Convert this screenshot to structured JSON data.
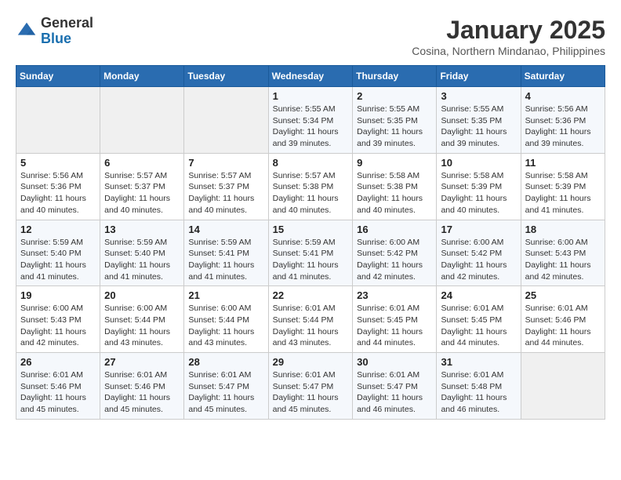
{
  "header": {
    "logo_line1": "General",
    "logo_line2": "Blue",
    "month": "January 2025",
    "location": "Cosina, Northern Mindanao, Philippines"
  },
  "weekdays": [
    "Sunday",
    "Monday",
    "Tuesday",
    "Wednesday",
    "Thursday",
    "Friday",
    "Saturday"
  ],
  "weeks": [
    [
      {
        "day": "",
        "sunrise": "",
        "sunset": "",
        "daylight": ""
      },
      {
        "day": "",
        "sunrise": "",
        "sunset": "",
        "daylight": ""
      },
      {
        "day": "",
        "sunrise": "",
        "sunset": "",
        "daylight": ""
      },
      {
        "day": "1",
        "sunrise": "Sunrise: 5:55 AM",
        "sunset": "Sunset: 5:34 PM",
        "daylight": "Daylight: 11 hours and 39 minutes."
      },
      {
        "day": "2",
        "sunrise": "Sunrise: 5:55 AM",
        "sunset": "Sunset: 5:35 PM",
        "daylight": "Daylight: 11 hours and 39 minutes."
      },
      {
        "day": "3",
        "sunrise": "Sunrise: 5:55 AM",
        "sunset": "Sunset: 5:35 PM",
        "daylight": "Daylight: 11 hours and 39 minutes."
      },
      {
        "day": "4",
        "sunrise": "Sunrise: 5:56 AM",
        "sunset": "Sunset: 5:36 PM",
        "daylight": "Daylight: 11 hours and 39 minutes."
      }
    ],
    [
      {
        "day": "5",
        "sunrise": "Sunrise: 5:56 AM",
        "sunset": "Sunset: 5:36 PM",
        "daylight": "Daylight: 11 hours and 40 minutes."
      },
      {
        "day": "6",
        "sunrise": "Sunrise: 5:57 AM",
        "sunset": "Sunset: 5:37 PM",
        "daylight": "Daylight: 11 hours and 40 minutes."
      },
      {
        "day": "7",
        "sunrise": "Sunrise: 5:57 AM",
        "sunset": "Sunset: 5:37 PM",
        "daylight": "Daylight: 11 hours and 40 minutes."
      },
      {
        "day": "8",
        "sunrise": "Sunrise: 5:57 AM",
        "sunset": "Sunset: 5:38 PM",
        "daylight": "Daylight: 11 hours and 40 minutes."
      },
      {
        "day": "9",
        "sunrise": "Sunrise: 5:58 AM",
        "sunset": "Sunset: 5:38 PM",
        "daylight": "Daylight: 11 hours and 40 minutes."
      },
      {
        "day": "10",
        "sunrise": "Sunrise: 5:58 AM",
        "sunset": "Sunset: 5:39 PM",
        "daylight": "Daylight: 11 hours and 40 minutes."
      },
      {
        "day": "11",
        "sunrise": "Sunrise: 5:58 AM",
        "sunset": "Sunset: 5:39 PM",
        "daylight": "Daylight: 11 hours and 41 minutes."
      }
    ],
    [
      {
        "day": "12",
        "sunrise": "Sunrise: 5:59 AM",
        "sunset": "Sunset: 5:40 PM",
        "daylight": "Daylight: 11 hours and 41 minutes."
      },
      {
        "day": "13",
        "sunrise": "Sunrise: 5:59 AM",
        "sunset": "Sunset: 5:40 PM",
        "daylight": "Daylight: 11 hours and 41 minutes."
      },
      {
        "day": "14",
        "sunrise": "Sunrise: 5:59 AM",
        "sunset": "Sunset: 5:41 PM",
        "daylight": "Daylight: 11 hours and 41 minutes."
      },
      {
        "day": "15",
        "sunrise": "Sunrise: 5:59 AM",
        "sunset": "Sunset: 5:41 PM",
        "daylight": "Daylight: 11 hours and 41 minutes."
      },
      {
        "day": "16",
        "sunrise": "Sunrise: 6:00 AM",
        "sunset": "Sunset: 5:42 PM",
        "daylight": "Daylight: 11 hours and 42 minutes."
      },
      {
        "day": "17",
        "sunrise": "Sunrise: 6:00 AM",
        "sunset": "Sunset: 5:42 PM",
        "daylight": "Daylight: 11 hours and 42 minutes."
      },
      {
        "day": "18",
        "sunrise": "Sunrise: 6:00 AM",
        "sunset": "Sunset: 5:43 PM",
        "daylight": "Daylight: 11 hours and 42 minutes."
      }
    ],
    [
      {
        "day": "19",
        "sunrise": "Sunrise: 6:00 AM",
        "sunset": "Sunset: 5:43 PM",
        "daylight": "Daylight: 11 hours and 42 minutes."
      },
      {
        "day": "20",
        "sunrise": "Sunrise: 6:00 AM",
        "sunset": "Sunset: 5:44 PM",
        "daylight": "Daylight: 11 hours and 43 minutes."
      },
      {
        "day": "21",
        "sunrise": "Sunrise: 6:00 AM",
        "sunset": "Sunset: 5:44 PM",
        "daylight": "Daylight: 11 hours and 43 minutes."
      },
      {
        "day": "22",
        "sunrise": "Sunrise: 6:01 AM",
        "sunset": "Sunset: 5:44 PM",
        "daylight": "Daylight: 11 hours and 43 minutes."
      },
      {
        "day": "23",
        "sunrise": "Sunrise: 6:01 AM",
        "sunset": "Sunset: 5:45 PM",
        "daylight": "Daylight: 11 hours and 44 minutes."
      },
      {
        "day": "24",
        "sunrise": "Sunrise: 6:01 AM",
        "sunset": "Sunset: 5:45 PM",
        "daylight": "Daylight: 11 hours and 44 minutes."
      },
      {
        "day": "25",
        "sunrise": "Sunrise: 6:01 AM",
        "sunset": "Sunset: 5:46 PM",
        "daylight": "Daylight: 11 hours and 44 minutes."
      }
    ],
    [
      {
        "day": "26",
        "sunrise": "Sunrise: 6:01 AM",
        "sunset": "Sunset: 5:46 PM",
        "daylight": "Daylight: 11 hours and 45 minutes."
      },
      {
        "day": "27",
        "sunrise": "Sunrise: 6:01 AM",
        "sunset": "Sunset: 5:46 PM",
        "daylight": "Daylight: 11 hours and 45 minutes."
      },
      {
        "day": "28",
        "sunrise": "Sunrise: 6:01 AM",
        "sunset": "Sunset: 5:47 PM",
        "daylight": "Daylight: 11 hours and 45 minutes."
      },
      {
        "day": "29",
        "sunrise": "Sunrise: 6:01 AM",
        "sunset": "Sunset: 5:47 PM",
        "daylight": "Daylight: 11 hours and 45 minutes."
      },
      {
        "day": "30",
        "sunrise": "Sunrise: 6:01 AM",
        "sunset": "Sunset: 5:47 PM",
        "daylight": "Daylight: 11 hours and 46 minutes."
      },
      {
        "day": "31",
        "sunrise": "Sunrise: 6:01 AM",
        "sunset": "Sunset: 5:48 PM",
        "daylight": "Daylight: 11 hours and 46 minutes."
      },
      {
        "day": "",
        "sunrise": "",
        "sunset": "",
        "daylight": ""
      }
    ]
  ]
}
